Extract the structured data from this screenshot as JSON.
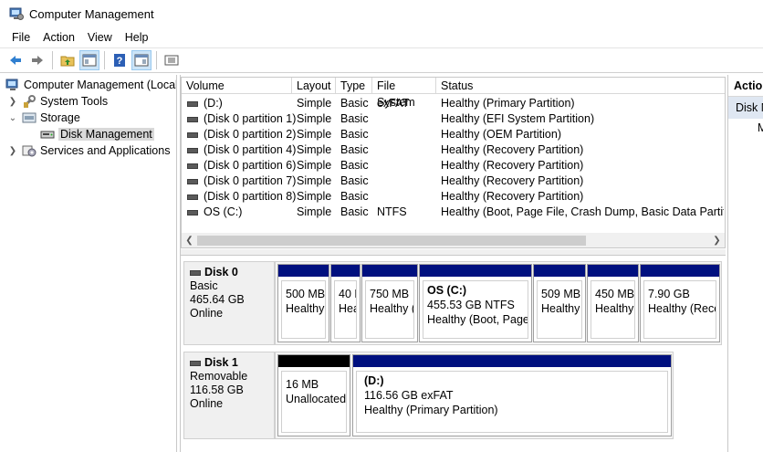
{
  "window": {
    "title": "Computer Management"
  },
  "menu": [
    "File",
    "Action",
    "View",
    "Help"
  ],
  "toolbar": {
    "buttons": [
      "back-arrow-icon",
      "forward-arrow-icon",
      "up-folder-icon",
      "show-hide-tree-icon",
      "help-icon",
      "properties-icon",
      "list-view-icon"
    ]
  },
  "nav": {
    "root": "Computer Management (Local",
    "system_tools": "System Tools",
    "storage": "Storage",
    "disk_management": "Disk Management",
    "services": "Services and Applications"
  },
  "volumes": {
    "columns": [
      "Volume",
      "Layout",
      "Type",
      "File System",
      "Status"
    ],
    "rows": [
      {
        "volume": "(D:)",
        "layout": "Simple",
        "type": "Basic",
        "fs": "exFAT",
        "status": "Healthy (Primary Partition)"
      },
      {
        "volume": "(Disk 0 partition 1)",
        "layout": "Simple",
        "type": "Basic",
        "fs": "",
        "status": "Healthy (EFI System Partition)"
      },
      {
        "volume": "(Disk 0 partition 2)",
        "layout": "Simple",
        "type": "Basic",
        "fs": "",
        "status": "Healthy (OEM Partition)"
      },
      {
        "volume": "(Disk 0 partition 4)",
        "layout": "Simple",
        "type": "Basic",
        "fs": "",
        "status": "Healthy (Recovery Partition)"
      },
      {
        "volume": "(Disk 0 partition 6)",
        "layout": "Simple",
        "type": "Basic",
        "fs": "",
        "status": "Healthy (Recovery Partition)"
      },
      {
        "volume": "(Disk 0 partition 7)",
        "layout": "Simple",
        "type": "Basic",
        "fs": "",
        "status": "Healthy (Recovery Partition)"
      },
      {
        "volume": "(Disk 0 partition 8)",
        "layout": "Simple",
        "type": "Basic",
        "fs": "",
        "status": "Healthy (Recovery Partition)"
      },
      {
        "volume": "OS (C:)",
        "layout": "Simple",
        "type": "Basic",
        "fs": "NTFS",
        "status": "Healthy (Boot, Page File, Crash Dump, Basic Data Partition)"
      }
    ]
  },
  "disks": [
    {
      "name": "Disk 0",
      "kind": "Basic",
      "size": "465.64 GB",
      "state": "Online",
      "partitions": [
        {
          "name": "",
          "line1": "500 MB",
          "line2": "Healthy"
        },
        {
          "name": "",
          "line1": "40 N",
          "line2": "Hea"
        },
        {
          "name": "",
          "line1": "750 MB",
          "line2": "Healthy ("
        },
        {
          "name": "OS  (C:)",
          "line1": "455.53 GB NTFS",
          "line2": "Healthy (Boot, Page"
        },
        {
          "name": "",
          "line1": "509 MB",
          "line2": "Healthy"
        },
        {
          "name": "",
          "line1": "450 MB",
          "line2": "Healthy"
        },
        {
          "name": "",
          "line1": "7.90 GB",
          "line2": "Healthy (Reco"
        }
      ]
    },
    {
      "name": "Disk 1",
      "kind": "Removable",
      "size": "116.58 GB",
      "state": "Online",
      "partitions": [
        {
          "name": "",
          "line1": "16 MB",
          "line2": "Unallocated"
        },
        {
          "name": "(D:)",
          "line1": "116.56 GB exFAT",
          "line2": "Healthy (Primary Partition)"
        }
      ]
    }
  ],
  "actions": {
    "header": "Actions",
    "subheader": "Disk Management",
    "item": "More Actions"
  },
  "colors": {
    "primary_bar": "#00107f",
    "unallocated_bar": "#000000",
    "selection": "#cce4f7"
  }
}
